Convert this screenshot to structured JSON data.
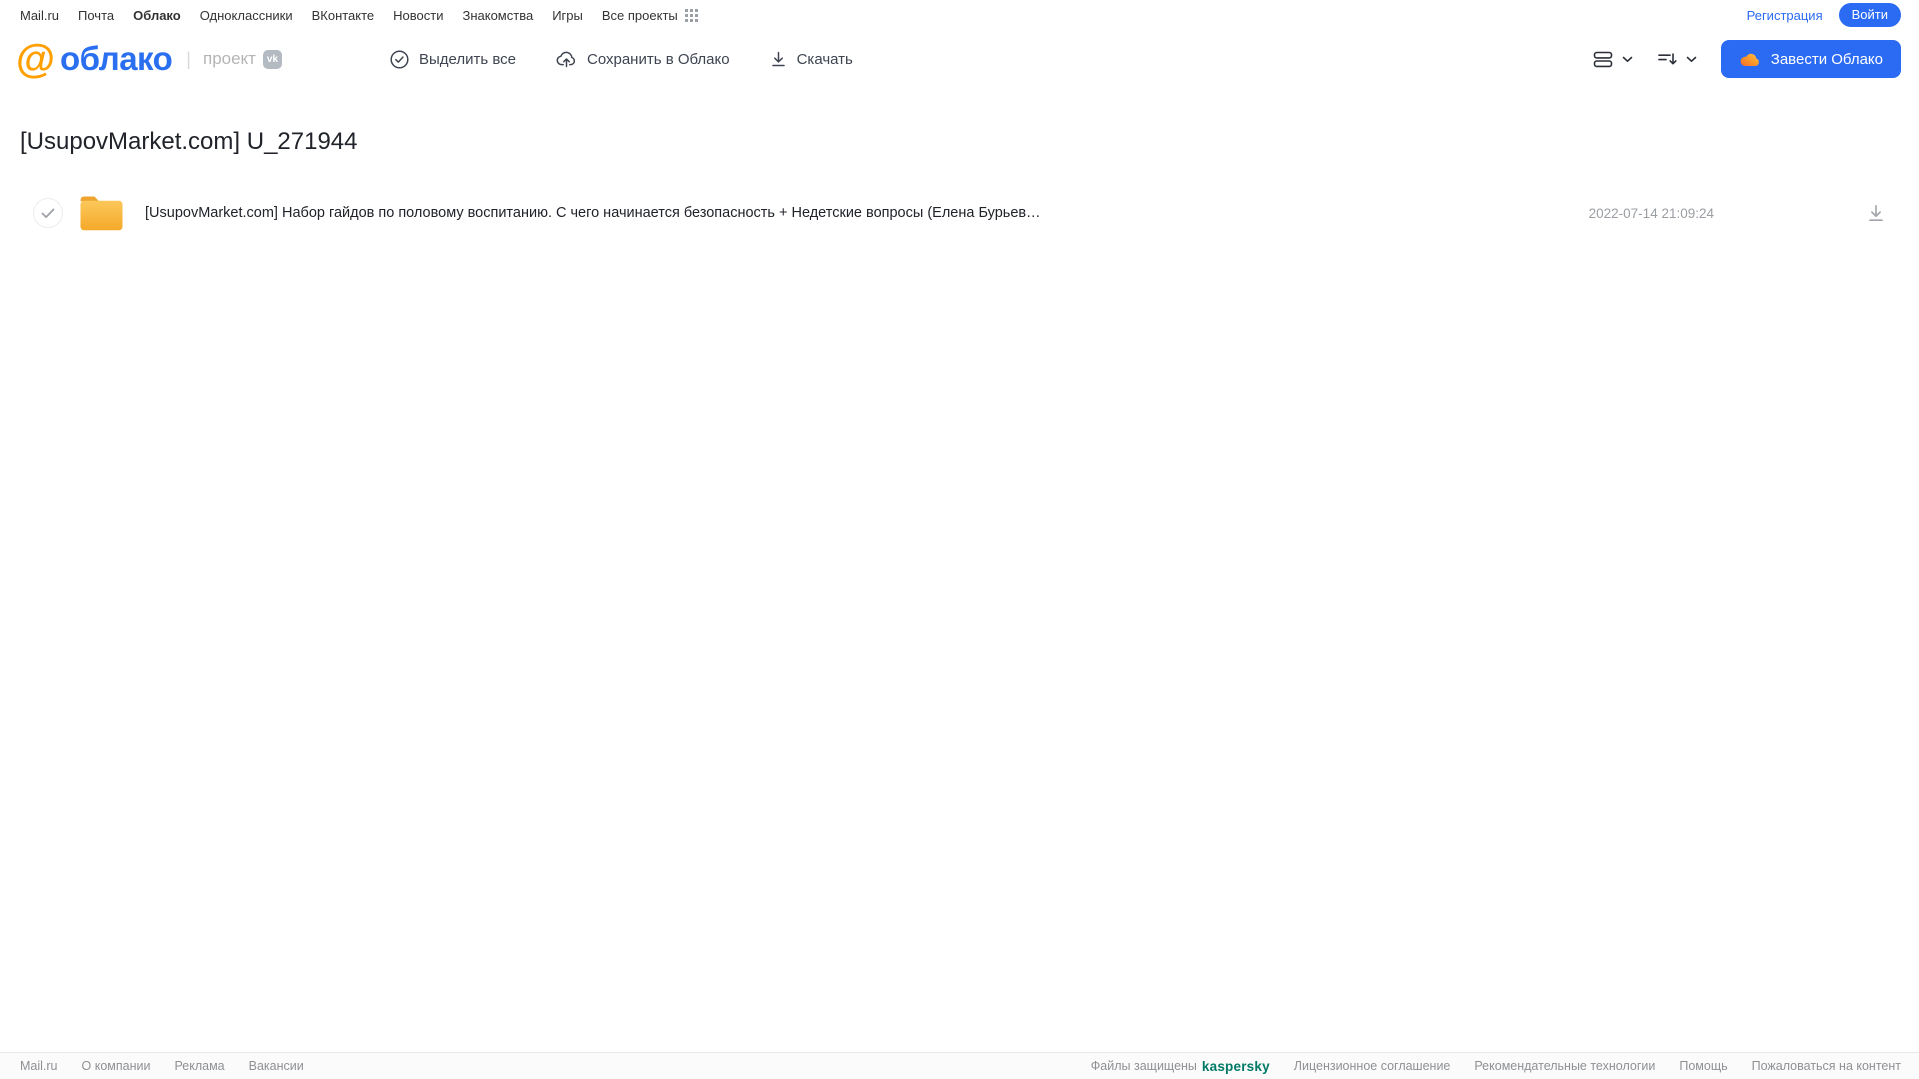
{
  "topnav": {
    "links": [
      "Mail.ru",
      "Почта",
      "Облако",
      "Одноклассники",
      "ВКонтакте",
      "Новости",
      "Знакомства",
      "Игры",
      "Все проекты"
    ],
    "registration_label": "Регистрация",
    "login_label": "Войти"
  },
  "header": {
    "brand": "облако",
    "at_sign": "@",
    "project_label": "проект",
    "vk_badge": "vk",
    "toolbar": {
      "select_all_label": "Выделить все",
      "save_to_cloud_label": "Сохранить в Облако",
      "download_label": "Скачать"
    },
    "get_cloud_label": "Завести Облако"
  },
  "main": {
    "title": "[UsupovMarket.com] U_271944",
    "files": [
      {
        "type": "folder",
        "name": "[UsupovMarket.com] Набор гайдов по половому воспитанию. С чего начинается безопасность + Недетские вопросы (Елена Бурьевая)",
        "modified": "2022-07-14 21:09:24"
      }
    ]
  },
  "footer": {
    "left_links": [
      "Mail.ru",
      "О компании",
      "Реклама",
      "Вакансии"
    ],
    "protected_label": "Файлы защищены",
    "kaspersky_label": "kaspersky",
    "right_links": [
      "Лицензионное соглашение",
      "Рекомендательные технологии",
      "Помощь",
      "Пожаловаться на контент"
    ]
  },
  "colors": {
    "accent_blue": "#2b6bf3",
    "logo_orange": "#ffa000",
    "folder_yellow": "#f7b733",
    "kaspersky_green": "#007a67"
  }
}
